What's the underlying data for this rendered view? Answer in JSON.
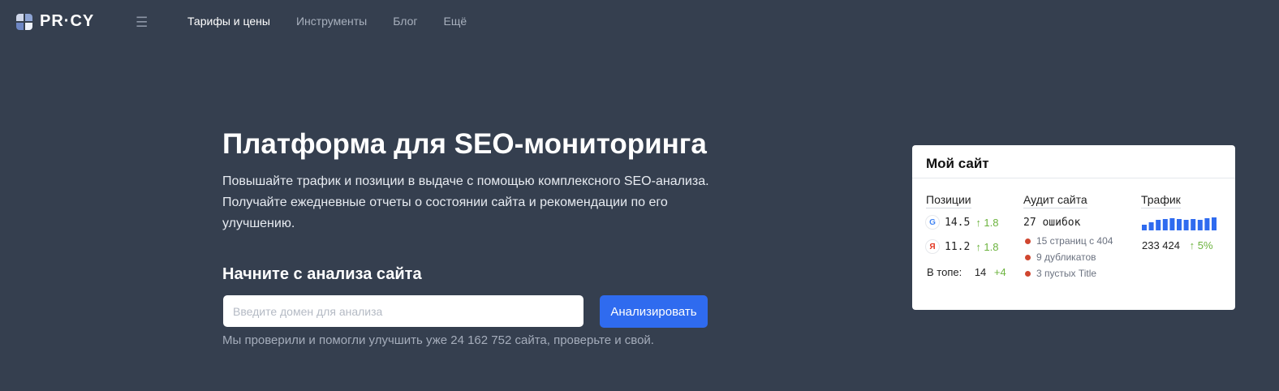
{
  "header": {
    "logo_text": "PR·CY",
    "nav": [
      {
        "label": "Тарифы и цены",
        "active": true
      },
      {
        "label": "Инструменты",
        "active": false
      },
      {
        "label": "Блог",
        "active": false
      },
      {
        "label": "Ещё",
        "active": false
      }
    ]
  },
  "hero": {
    "title": "Платформа для SEO-мониторинга",
    "description": "Повышайте трафик и позиции в выдаче с помощью комплексного SEO-анализа. Получайте ежедневные отчеты о состоянии сайта и рекомендации по его улучшению.",
    "section_title": "Начните с анализа сайта",
    "input_placeholder": "Введите домен для анализа",
    "button_label": "Анализировать",
    "note": "Мы проверили и помогли улучшить уже 24 162 752 сайта, проверьте и свой."
  },
  "card": {
    "title": "Мой сайт",
    "positions": {
      "heading": "Позиции",
      "google": {
        "value": "14.5",
        "delta": "↑ 1.8"
      },
      "yandex": {
        "value": "11.2",
        "delta": "↑ 1.8"
      },
      "top_label": "В топе:",
      "top_value": "14",
      "top_delta": "+4"
    },
    "audit": {
      "heading": "Аудит сайта",
      "total": "27 ошибок",
      "items": [
        "15 страниц с 404",
        "9 дубликатов",
        "3 пустых Title"
      ]
    },
    "traffic": {
      "heading": "Трафик",
      "bar_levels": [
        0.4,
        0.55,
        0.7,
        0.8,
        0.85,
        0.75,
        0.7,
        0.8,
        0.7,
        0.85,
        0.9
      ],
      "bar_color": "#2f6bef",
      "value": "233 424",
      "delta": "↑ 5%"
    }
  },
  "colors": {
    "background": "#353f4f",
    "accent": "#2f6bef",
    "positive": "#6cb33e",
    "error": "#d0462f"
  }
}
